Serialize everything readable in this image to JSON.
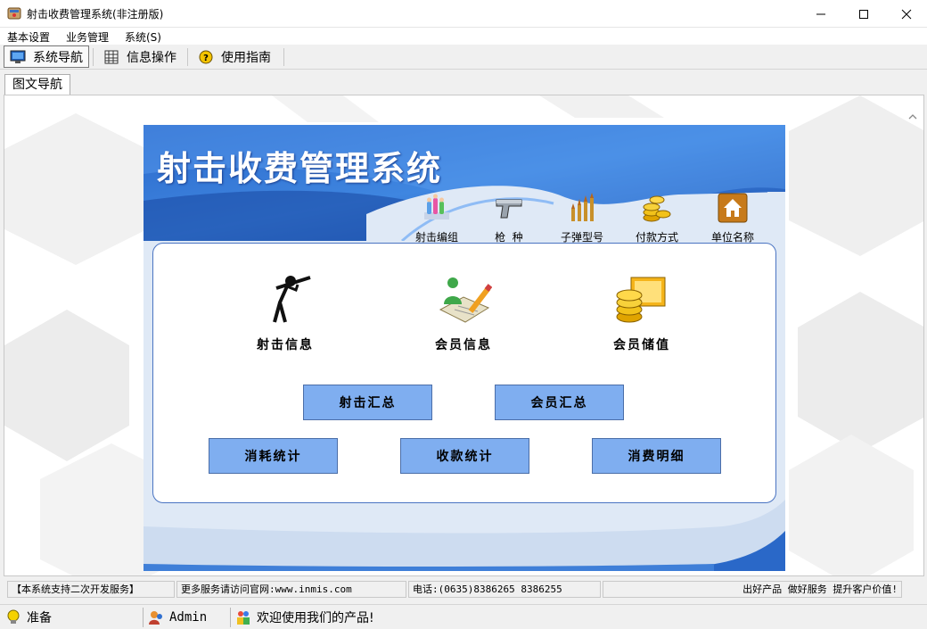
{
  "window": {
    "title": "射击收费管理系统(非注册版)"
  },
  "menu": [
    "基本设置",
    "业务管理",
    "系统(S)"
  ],
  "toolbar": {
    "items": [
      "系统导航",
      "信息操作",
      "使用指南"
    ]
  },
  "tabs": [
    "图文导航"
  ],
  "panel": {
    "title": "射击收费管理系统",
    "shortcuts": [
      "射击编组",
      "枪  种",
      "子弹型号",
      "付款方式",
      "单位名称"
    ],
    "big_icons": [
      "射击信息",
      "会员信息",
      "会员储值"
    ],
    "buttons_row1": [
      "射击汇总",
      "会员汇总"
    ],
    "buttons_row2": [
      "消耗统计",
      "收款统计",
      "消费明细"
    ]
  },
  "infobar": {
    "cells": [
      "【本系统支持二次开发服务】",
      "更多服务请访问官网:www.inmis.com",
      "电话:(0635)8386265 8386255",
      "出好产品 做好服务 提升客户价值!"
    ]
  },
  "statusbar": {
    "status": "准备",
    "user": "Admin",
    "message": "欢迎使用我们的产品!"
  },
  "colors": {
    "accent_blue": "#2a68c8",
    "button_blue": "#7faef0"
  }
}
